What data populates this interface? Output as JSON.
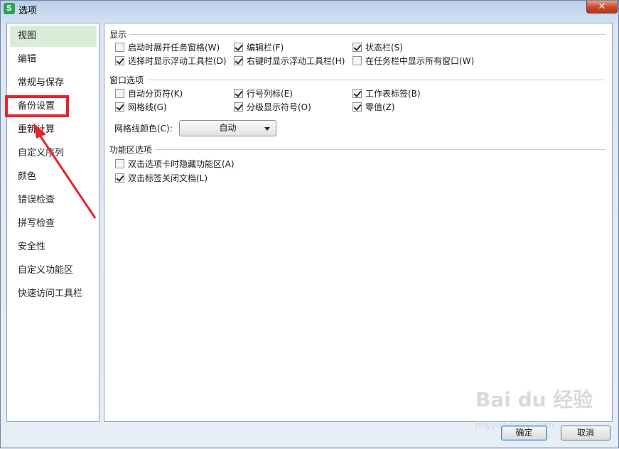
{
  "window": {
    "title": "选项",
    "app_icon": "S",
    "close_label": "✕"
  },
  "sidebar": {
    "items": [
      {
        "label": "视图",
        "selected": true
      },
      {
        "label": "编辑"
      },
      {
        "label": "常规与保存"
      },
      {
        "label": "备份设置"
      },
      {
        "label": "重新计算"
      },
      {
        "label": "自定义序列"
      },
      {
        "label": "颜色"
      },
      {
        "label": "错误检查"
      },
      {
        "label": "拼写检查"
      },
      {
        "label": "安全性"
      },
      {
        "label": "自定义功能区"
      },
      {
        "label": "快速访问工具栏"
      }
    ]
  },
  "display_group": {
    "title": "显示",
    "options": [
      {
        "label": "启动时展开任务窗格(W)",
        "checked": false
      },
      {
        "label": "编辑栏(F)",
        "checked": true
      },
      {
        "label": "状态栏(S)",
        "checked": true
      },
      {
        "label": "选择时显示浮动工具栏(D)",
        "checked": true
      },
      {
        "label": "右键时显示浮动工具栏(H)",
        "checked": true
      },
      {
        "label": "在任务栏中显示所有窗口(W)",
        "checked": false
      }
    ]
  },
  "window_group": {
    "title": "窗口选项",
    "options": [
      {
        "label": "自动分页符(K)",
        "checked": false
      },
      {
        "label": "行号列标(E)",
        "checked": true
      },
      {
        "label": "工作表标签(B)",
        "checked": true
      },
      {
        "label": "网格线(G)",
        "checked": true
      },
      {
        "label": "分级显示符号(O)",
        "checked": true
      },
      {
        "label": "零值(Z)",
        "checked": true
      }
    ],
    "gridline_color_label": "网格线颜色(C):",
    "gridline_color_value": "自动"
  },
  "ribbon_group": {
    "title": "功能区选项",
    "options": [
      {
        "label": "双击选项卡时隐藏功能区(A)",
        "checked": false
      },
      {
        "label": "双击标签关闭文档(L)",
        "checked": true
      }
    ]
  },
  "footer": {
    "ok_label": "确定",
    "cancel_label": "取消"
  },
  "annotation": {
    "color": "#e8222b"
  },
  "watermark": {
    "text": "Bai du 经验",
    "sub": "jingyan.baidu.com"
  }
}
